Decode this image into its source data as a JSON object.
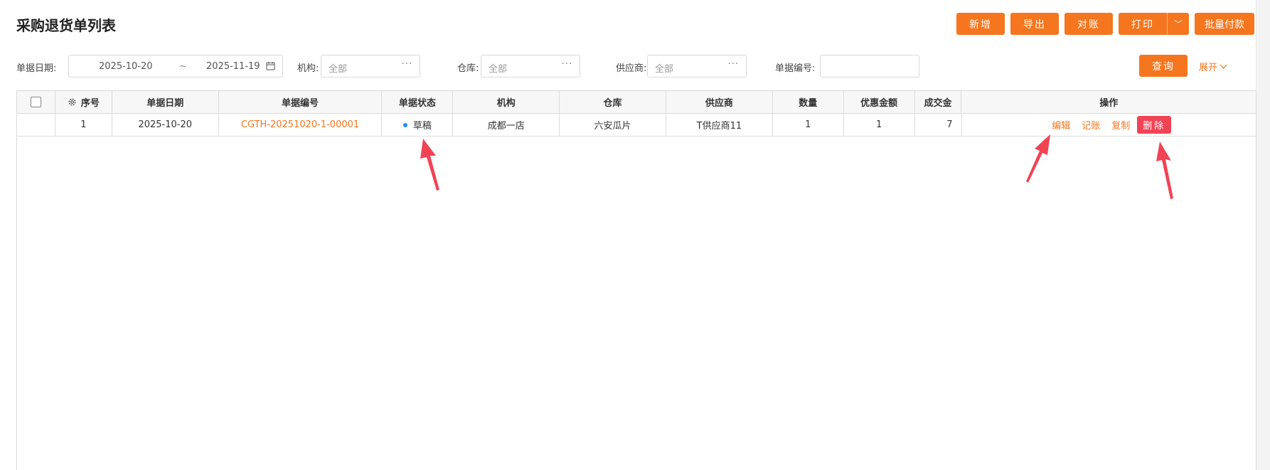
{
  "page": {
    "title": "采购退货单列表"
  },
  "toolbar": {
    "add": "新增",
    "export": "导出",
    "reconcile": "对账",
    "print": "打印",
    "print_caret": "﹀",
    "batch_pay": "批量付款"
  },
  "filters": {
    "date_label": "单据日期:",
    "date_start": "2025-10-20",
    "date_sep": "~",
    "date_end": "2025-11-19",
    "org_label": "机构:",
    "org_value": "全部",
    "warehouse_label": "仓库:",
    "warehouse_value": "全部",
    "supplier_label": "供应商:",
    "supplier_value": "全部",
    "doc_no_label": "单据编号:",
    "doc_no_value": "",
    "query": "查询",
    "expand": "展开",
    "more_glyph": "···"
  },
  "table": {
    "headers": {
      "seq": "序号",
      "date": "单据日期",
      "doc_no": "单据编号",
      "status": "单据状态",
      "org": "机构",
      "warehouse": "仓库",
      "supplier": "供应商",
      "qty": "数量",
      "discount": "优惠金额",
      "amount": "成交金",
      "ops": "操作"
    },
    "rows": [
      {
        "seq": "1",
        "date": "2025-10-20",
        "doc_no": "CGTH-20251020-1-00001",
        "status": "草稿",
        "org": "成都一店",
        "warehouse": "六安瓜片",
        "supplier": "T供应商11",
        "qty": "1",
        "discount": "1",
        "amount": "7",
        "ops": {
          "edit": "编辑",
          "post": "记账",
          "copy": "复制",
          "delete": "删除"
        }
      }
    ]
  },
  "colors": {
    "accent": "#f5761e",
    "danger": "#f04455",
    "status_draft": "#1e90ff",
    "annotation_arrow": "#f04455"
  }
}
